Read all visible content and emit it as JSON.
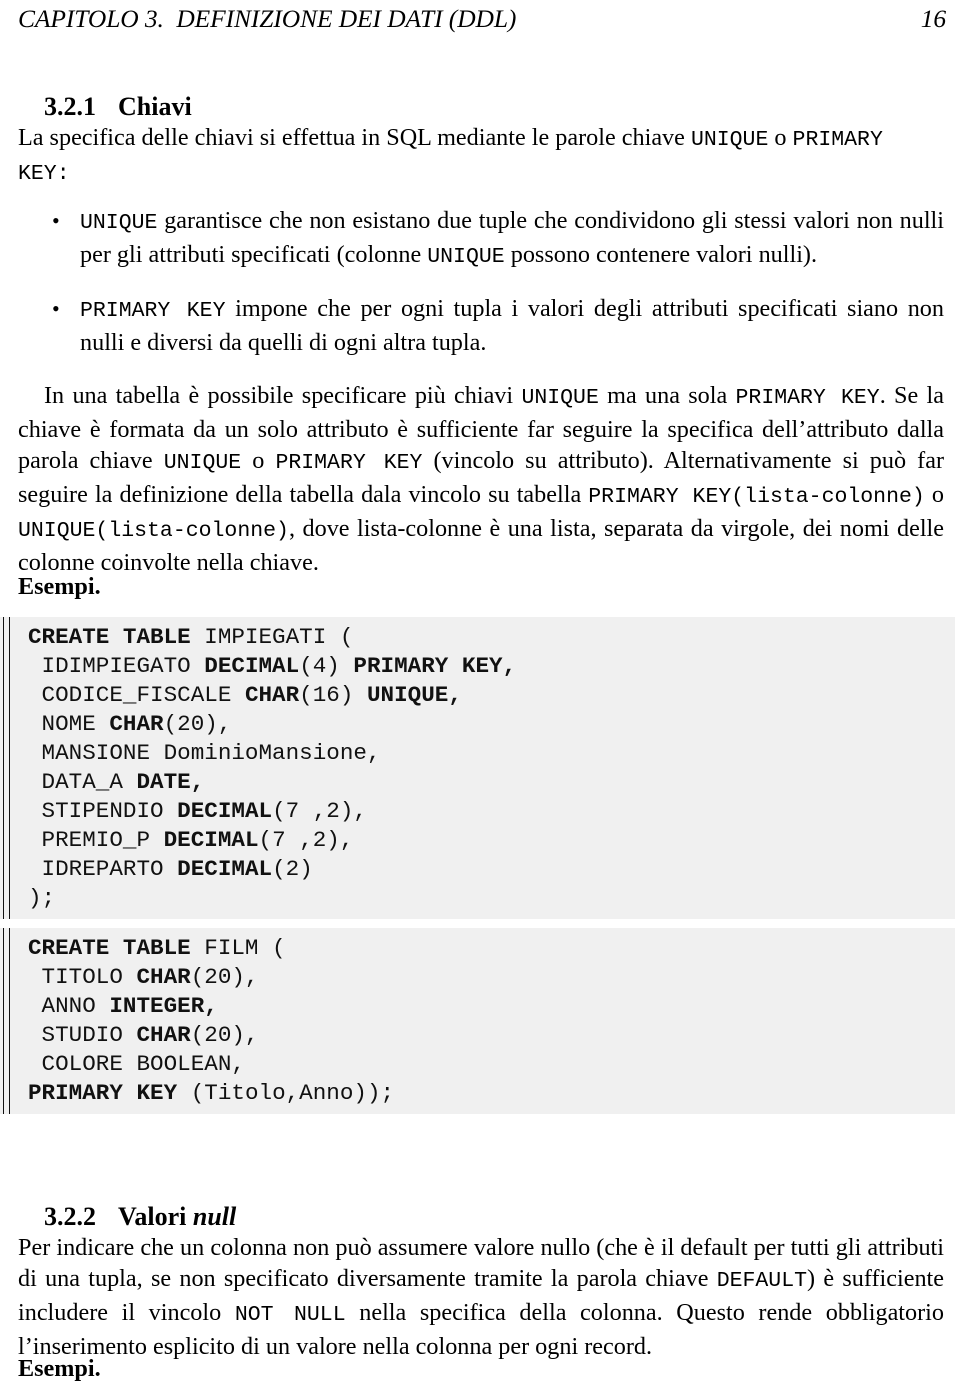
{
  "header": {
    "chapter_title": "CAPITOLO 3.  DEFINIZIONE DEI DATI (DDL)",
    "page_number": "16"
  },
  "sections": {
    "chiavi": {
      "number": "3.2.1",
      "title": "Chiavi"
    },
    "valori_null": {
      "number": "3.2.2",
      "title_plain": "Valori ",
      "title_italic": "null"
    }
  },
  "intro": {
    "line1_a": "La specifica delle chiavi si effettua in SQL mediante le parole chiave ",
    "line1_kw1": "UNIQUE",
    "line1_b": " o ",
    "line1_kw2": "PRIMARY",
    "line2_kw": "KEY:"
  },
  "bullets": [
    {
      "marker": "•",
      "kw1": "UNIQUE",
      "text_a": " garantisce che non esistano due tuple che condividono gli stessi valori non nulli per gli attributi specificati (colonne ",
      "kw2": "UNIQUE",
      "text_b": " possono contenere valori nulli)."
    },
    {
      "marker": "•",
      "kw1": "PRIMARY KEY",
      "text_a": " impone che per ogni tupla i valori degli attributi specificati siano non nulli e diversi da quelli di ogni altra tupla.",
      "kw2": "",
      "text_b": ""
    }
  ],
  "paragraph_keys": {
    "t1": "In una tabella è possibile specificare più chiavi ",
    "k1": "UNIQUE",
    "t2": " ma una sola ",
    "k2": "PRIMARY KEY",
    "t3": ". Se la chiave è formata da un solo attributo è sufficiente far seguire la specifica dell’attributo dalla parola chiave ",
    "k3": "UNIQUE",
    "t4": " o ",
    "k4": "PRIMARY KEY",
    "t5": " (vincolo su attributo).  Alternativamente si può far seguire la definizione della tabella dala vincolo su tabella ",
    "k5": "PRIMARY KEY(lista‐colonne)",
    "t6": " o ",
    "k6": "UNIQUE(lista‐colonne)",
    "t7": ", dove lista‐colonne è una lista, separata da virgole, dei nomi delle colonne coinvolte nella chiave."
  },
  "esempi_label_1": "Esempi.",
  "esempi_label_2": "Esempi.",
  "code_blocks": [
    {
      "name": "create-table-impiegati",
      "lines": [
        [
          {
            "t": "CREATE TABLE",
            "b": true
          },
          {
            "t": " IMPIEGATI (",
            "b": false
          }
        ],
        [
          {
            "t": " IDIMPIEGATO ",
            "b": false
          },
          {
            "t": "DECIMAL",
            "b": true
          },
          {
            "t": "(4) ",
            "b": false
          },
          {
            "t": "PRIMARY KEY,",
            "b": true
          }
        ],
        [
          {
            "t": " CODICE_FISCALE ",
            "b": false
          },
          {
            "t": "CHAR",
            "b": true
          },
          {
            "t": "(16) ",
            "b": false
          },
          {
            "t": "UNIQUE,",
            "b": true
          }
        ],
        [
          {
            "t": " NOME ",
            "b": false
          },
          {
            "t": "CHAR",
            "b": true
          },
          {
            "t": "(20),",
            "b": false
          }
        ],
        [
          {
            "t": " MANSIONE DominioMansione,",
            "b": false
          }
        ],
        [
          {
            "t": " DATA_A ",
            "b": false
          },
          {
            "t": "DATE,",
            "b": true
          }
        ],
        [
          {
            "t": " STIPENDIO ",
            "b": false
          },
          {
            "t": "DECIMAL",
            "b": true
          },
          {
            "t": "(7 ,2),",
            "b": false
          }
        ],
        [
          {
            "t": " PREMIO_P ",
            "b": false
          },
          {
            "t": "DECIMAL",
            "b": true
          },
          {
            "t": "(7 ,2),",
            "b": false
          }
        ],
        [
          {
            "t": " IDREPARTO ",
            "b": false
          },
          {
            "t": "DECIMAL",
            "b": true
          },
          {
            "t": "(2)",
            "b": false
          }
        ],
        [
          {
            "t": ");",
            "b": false
          }
        ]
      ]
    },
    {
      "name": "create-table-film",
      "lines": [
        [
          {
            "t": "CREATE TABLE",
            "b": true
          },
          {
            "t": " FILM (",
            "b": false
          }
        ],
        [
          {
            "t": " TITOLO ",
            "b": false
          },
          {
            "t": "CHAR",
            "b": true
          },
          {
            "t": "(20),",
            "b": false
          }
        ],
        [
          {
            "t": " ANNO ",
            "b": false
          },
          {
            "t": "INTEGER,",
            "b": true
          }
        ],
        [
          {
            "t": " STUDIO ",
            "b": false
          },
          {
            "t": "CHAR",
            "b": true
          },
          {
            "t": "(20),",
            "b": false
          }
        ],
        [
          {
            "t": " COLORE BOOLEAN,",
            "b": false
          }
        ],
        [
          {
            "t": "PRIMARY KEY",
            "b": true
          },
          {
            "t": " (Titolo,Anno));",
            "b": false
          }
        ]
      ]
    }
  ],
  "paragraph_null": {
    "t1": "Per indicare che un colonna non può assumere valore nullo (che è il default per tutti gli attributi di una tupla, se non specificato diversamente tramite la parola chiave ",
    "k1": "DEFAULT",
    "t2": ") è sufficiente includere il vincolo ",
    "k2": "NOT  NULL",
    "t3": " nella specifica della colonna.  Questo rende obbligatorio l’inserimento esplicito di un valore nella colonna per ogni record."
  },
  "colors": {
    "page_background": "#ffffff",
    "code_background": "#f0f0f0",
    "text": "#000000",
    "rule": "#111111"
  }
}
